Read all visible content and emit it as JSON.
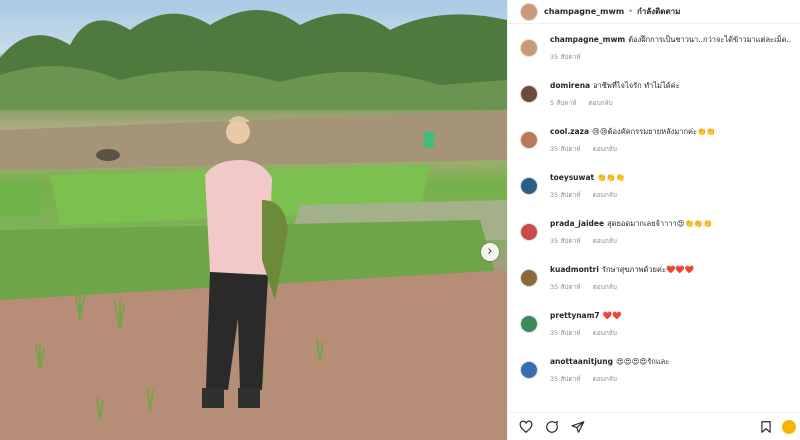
{
  "header": {
    "username": "champagne_mwm",
    "separator": "•",
    "follow_label": "กำลังติดตาม"
  },
  "comments": [
    {
      "username": "champagne_mwm",
      "text": "ต้องฝึกการเป็นชาวนา..กว่าจะได้ข้าวมาแต่ละเม็ด..",
      "time": "35 สัปดาห์",
      "reply": "",
      "avatar_color": "#c99a7a"
    },
    {
      "username": "domirena",
      "text": "อาชีพที่ไจไจรัก ทำไม่ได้ค่ะ",
      "time": "5 สัปดาห์",
      "reply": "ตอบกลับ",
      "avatar_color": "#6e4a3a"
    },
    {
      "username": "cool.zaza",
      "text": "😢😢ต้องคัดกรรมยายหลังมากค่ะ👏👏",
      "time": "35 สัปดาห์",
      "reply": "ตอบกลับ",
      "avatar_color": "#b87a5a"
    },
    {
      "username": "toeysuwat",
      "text": "👏👏👏",
      "time": "35 สัปดาห์",
      "reply": "ตอบกลับ",
      "avatar_color": "#2a5d8a"
    },
    {
      "username": "prada_jaidee",
      "text": "สุดยอดมากเลยจ้าาาา😍👏👏👏",
      "time": "35 สัปดาห์",
      "reply": "ตอบกลับ",
      "avatar_color": "#c94b4b"
    },
    {
      "username": "kuadmontri",
      "text": "รักษาสุขภาพด้วยค่ะ❤️❤️❤️",
      "time": "35 สัปดาห์",
      "reply": "ตอบกลับ",
      "avatar_color": "#8a6a3a"
    },
    {
      "username": "prettynam7",
      "text": "❤️❤️",
      "time": "35 สัปดาห์",
      "reply": "ตอบกลับ",
      "avatar_color": "#3e8a5a"
    },
    {
      "username": "anottaanitjung",
      "text": "😍😍😍😍รักและ",
      "time": "35 สัปดาห์",
      "reply": "ตอบกลับ",
      "avatar_color": "#3a6ab0"
    }
  ],
  "icons": {
    "like": "heart-icon",
    "comment": "comment-icon",
    "share": "share-icon",
    "save": "bookmark-icon"
  },
  "colors": {
    "text": "#262626",
    "meta": "#8e8e8e",
    "border": "#efefef"
  }
}
